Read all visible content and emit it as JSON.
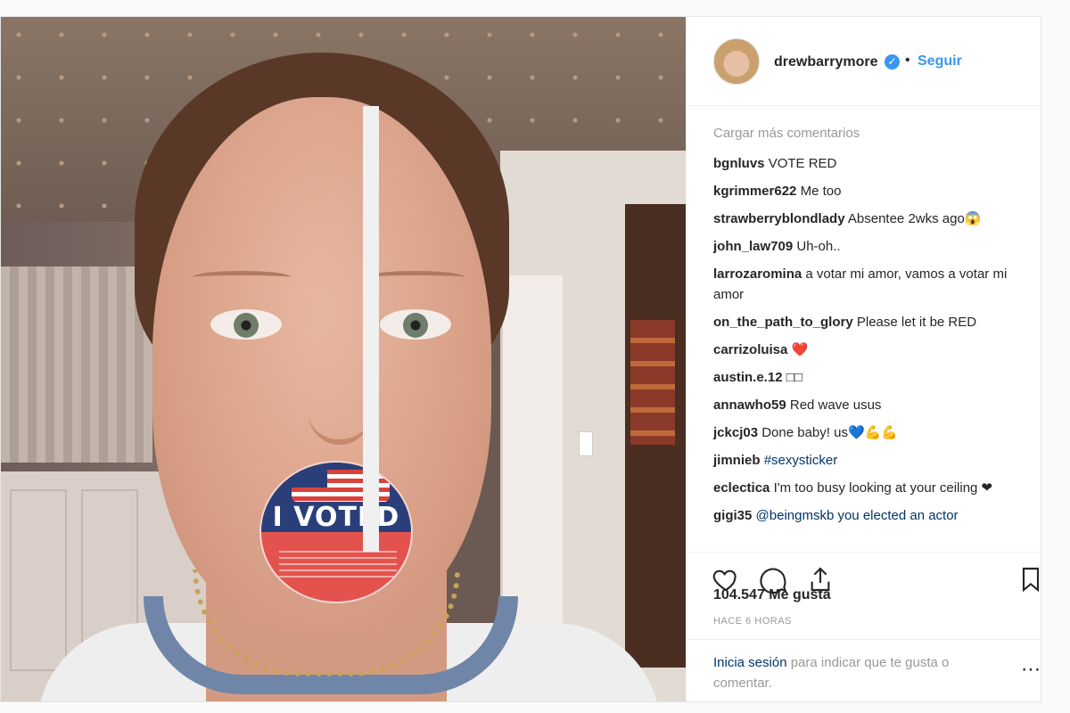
{
  "post": {
    "username": "drewbarrymore",
    "follow_label": "Seguir",
    "separator": "•",
    "sticker_text": "I VOTED"
  },
  "comments_panel": {
    "load_more": "Cargar más comentarios",
    "comments": [
      {
        "user": "bgnluvs",
        "text": "VOTE RED"
      },
      {
        "user": "kgrimmer622",
        "text": "Me too"
      },
      {
        "user": "strawberryblondlady",
        "text": "Absentee 2wks ago😱"
      },
      {
        "user": "john_law709",
        "text": "Uh-oh.."
      },
      {
        "user": "larrozaromina",
        "text": "a votar mi amor, vamos a votar mi amor"
      },
      {
        "user": "on_the_path_to_glory",
        "text": "Please let it be RED"
      },
      {
        "user": "carrizoluisa",
        "text": "❤️"
      },
      {
        "user": "austin.e.12",
        "text": "□□"
      },
      {
        "user": "annawho59",
        "text": "Red wave usus"
      },
      {
        "user": "jckcj03",
        "text": "Done baby! us💙💪💪"
      },
      {
        "user": "jimnieb",
        "text": "#sexysticker",
        "is_tag": true
      },
      {
        "user": "eclectica",
        "text": "I'm too busy looking at your ceiling ❤"
      },
      {
        "user": "gigi35",
        "text": "@beingmskb you elected an actor",
        "is_tag": true
      }
    ]
  },
  "actions": {
    "likes": "104.547 Me gusta",
    "time": "HACE 6 HORAS"
  },
  "login": {
    "link": "Inicia sesión",
    "text": " para indicar que te gusta o comentar.",
    "more": "⋯"
  },
  "colors": {
    "link": "#3897f0",
    "text": "#262626",
    "muted": "#999999"
  }
}
